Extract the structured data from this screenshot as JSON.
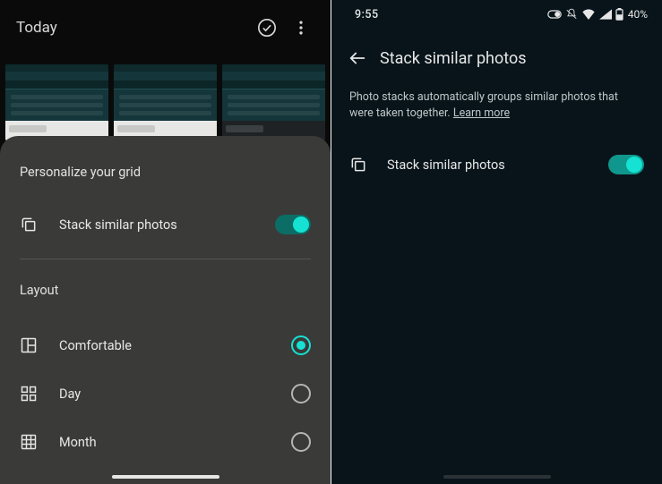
{
  "left": {
    "header_title": "Today",
    "sheet": {
      "personalize_heading": "Personalize your grid",
      "stack_label": "Stack similar photos",
      "stack_on": true,
      "layout_heading": "Layout",
      "options": [
        {
          "label": "Comfortable",
          "selected": true
        },
        {
          "label": "Day",
          "selected": false
        },
        {
          "label": "Month",
          "selected": false
        }
      ]
    }
  },
  "right": {
    "status": {
      "time": "9:55",
      "battery": "40%"
    },
    "title": "Stack similar photos",
    "description": "Photo stacks automatically groups similar photos that were taken together. ",
    "learn_more": "Learn more",
    "row": {
      "label": "Stack similar photos",
      "on": true
    }
  }
}
